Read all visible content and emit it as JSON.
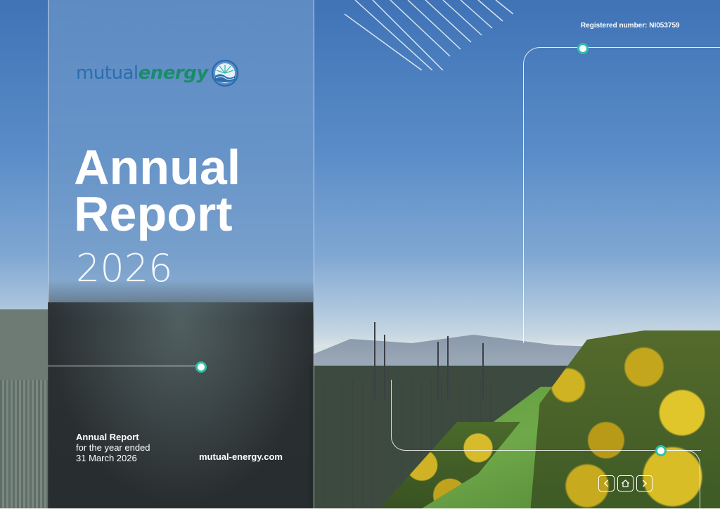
{
  "logo": {
    "word1": "mutual",
    "word2": "energy"
  },
  "cover": {
    "title_line1": "Annual",
    "title_line2": "Report",
    "year": "2026"
  },
  "registered": "Registered number: NI053759",
  "footer": {
    "line1": "Annual Report",
    "line2": "for the year ended",
    "line3": "31 March 2026",
    "website": "mutual-energy.com"
  },
  "nav": {
    "icons": [
      "chevron-left-icon",
      "home-icon",
      "chevron-right-icon"
    ]
  },
  "colors": {
    "accent_teal": "#2fbfa7",
    "logo_blue": "#2b6db0",
    "logo_green": "#1a8c6a"
  }
}
